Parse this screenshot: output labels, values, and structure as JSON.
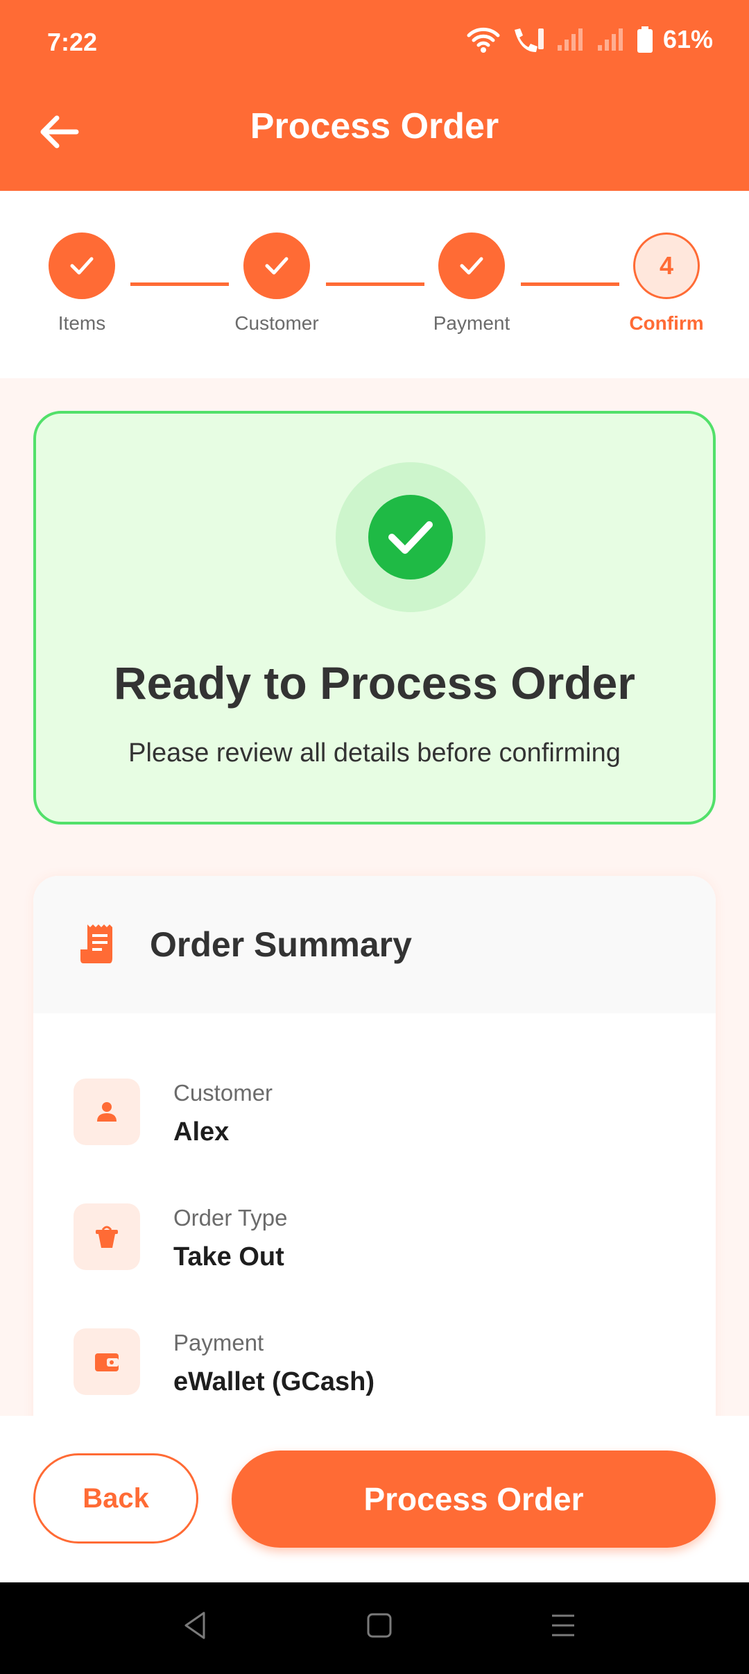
{
  "status_bar": {
    "time": "7:22",
    "battery": "61%"
  },
  "header": {
    "title": "Process Order"
  },
  "stepper": {
    "steps": [
      {
        "label": "Items",
        "state": "done"
      },
      {
        "label": "Customer",
        "state": "done"
      },
      {
        "label": "Payment",
        "state": "done"
      },
      {
        "label": "Confirm",
        "state": "current",
        "number": "4"
      }
    ]
  },
  "ready": {
    "title": "Ready to Process Order",
    "subtitle": "Please review all details before confirming"
  },
  "summary": {
    "title": "Order Summary",
    "rows": [
      {
        "label": "Customer",
        "value": "Alex",
        "icon": "person-icon"
      },
      {
        "label": "Order Type",
        "value": "Take Out",
        "icon": "takeout-icon"
      },
      {
        "label": "Payment",
        "value": "eWallet (GCash)",
        "icon": "wallet-icon"
      }
    ]
  },
  "actions": {
    "back_label": "Back",
    "process_label": "Process Order"
  },
  "colors": {
    "accent": "#ff6b35",
    "success": "#1fba45",
    "success_bg": "#e7fde3"
  }
}
